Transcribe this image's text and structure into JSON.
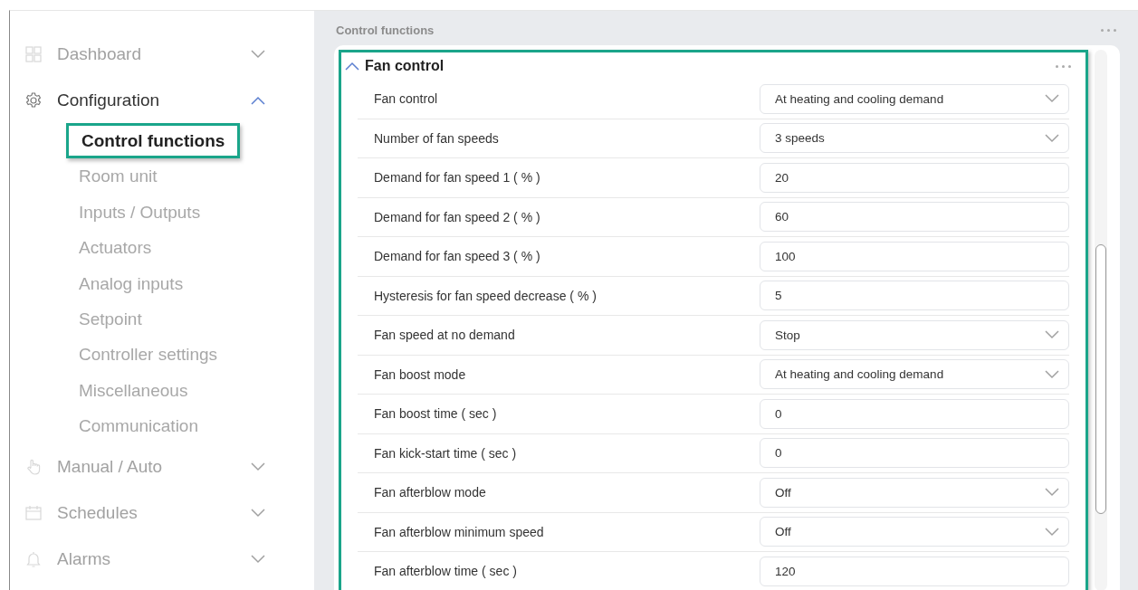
{
  "sidebar": {
    "items": [
      {
        "label": "Dashboard",
        "expanded": false
      },
      {
        "label": "Configuration",
        "expanded": true,
        "children": [
          {
            "label": "Control functions",
            "selected": true
          },
          {
            "label": "Room unit",
            "selected": false
          },
          {
            "label": "Inputs / Outputs",
            "selected": false
          },
          {
            "label": "Actuators",
            "selected": false
          },
          {
            "label": "Analog inputs",
            "selected": false
          },
          {
            "label": "Setpoint",
            "selected": false
          },
          {
            "label": "Controller settings",
            "selected": false
          },
          {
            "label": "Miscellaneous",
            "selected": false
          },
          {
            "label": "Communication",
            "selected": false
          }
        ]
      },
      {
        "label": "Manual / Auto",
        "expanded": false
      },
      {
        "label": "Schedules",
        "expanded": false
      },
      {
        "label": "Alarms",
        "expanded": false
      }
    ]
  },
  "page": {
    "title": "Control functions"
  },
  "section": {
    "title": "Fan control",
    "expanded": true,
    "highlighted": true,
    "rows": [
      {
        "label": "Fan control",
        "kind": "select",
        "value": "At heating and cooling demand"
      },
      {
        "label": "Number of fan speeds",
        "kind": "select",
        "value": "3 speeds"
      },
      {
        "label": "Demand for fan speed 1 ( % )",
        "kind": "input",
        "value": "20"
      },
      {
        "label": "Demand for fan speed 2 ( % )",
        "kind": "input",
        "value": "60"
      },
      {
        "label": "Demand for fan speed 3 ( % )",
        "kind": "input",
        "value": "100"
      },
      {
        "label": "Hysteresis for fan speed decrease ( % )",
        "kind": "input",
        "value": "5"
      },
      {
        "label": "Fan speed at no demand",
        "kind": "select",
        "value": "Stop"
      },
      {
        "label": "Fan boost mode",
        "kind": "select",
        "value": "At heating and cooling demand"
      },
      {
        "label": "Fan boost time ( sec )",
        "kind": "input",
        "value": "0"
      },
      {
        "label": "Fan kick-start time ( sec )",
        "kind": "input",
        "value": "0"
      },
      {
        "label": "Fan afterblow mode",
        "kind": "select",
        "value": "Off"
      },
      {
        "label": "Fan afterblow minimum speed",
        "kind": "select",
        "value": "Off"
      },
      {
        "label": "Fan afterblow time ( sec )",
        "kind": "input",
        "value": "120"
      }
    ]
  }
}
